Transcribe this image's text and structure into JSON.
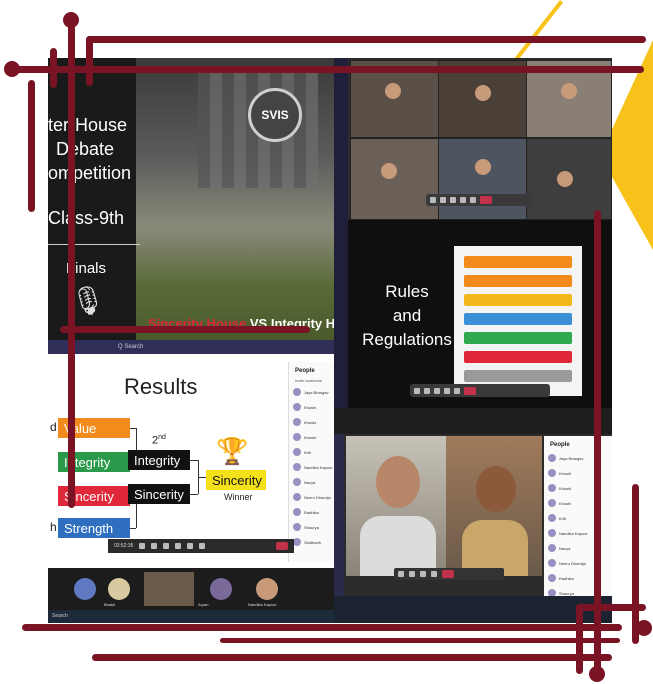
{
  "slide1": {
    "title_lines": [
      "ter-House",
      "Debate",
      "ompetition"
    ],
    "class_label": "Class-9th",
    "finals_label": "Finals",
    "building_sign": "SVIS",
    "vs_left": "Sincerity House",
    "vs_mid": " VS ",
    "vs_right": "Integrity H"
  },
  "slide2": {
    "title_lines": [
      "Rules",
      "and",
      "Regulations"
    ],
    "rules": [
      {
        "color": "#f28a1c"
      },
      {
        "color": "#f28a1c"
      },
      {
        "color": "#f2b81c"
      },
      {
        "color": "#3a8fd6"
      },
      {
        "color": "#2fa84f"
      },
      {
        "color": "#e0283a"
      },
      {
        "color": "#9a9a9a"
      }
    ]
  },
  "results": {
    "search_placeholder": "Q Search",
    "title": "Results",
    "round1": [
      {
        "prefix": "d",
        "label": "Value",
        "color": "#f28a1c"
      },
      {
        "prefix": "",
        "label": "Integrity",
        "color": "#2a9a4a"
      },
      {
        "prefix": "",
        "label": "Sincerity",
        "color": "#e0283a"
      },
      {
        "prefix": "h",
        "label": "Strength",
        "color": "#2f6fc0"
      }
    ],
    "round2_heading": "2",
    "round2_sup": "nd",
    "round2": [
      "Integrity",
      "Sincerity"
    ],
    "winner_box": "Sincerity",
    "winner_label": "Winner",
    "call_time": "03:52:35"
  },
  "people_panel": {
    "title": "People",
    "invite": "Invite someone",
    "names": [
      "Jaya Bhargav",
      "Khushi",
      "Khushi",
      "Khushi",
      "Kriti",
      "Nandika Kapoor",
      "Navya",
      "Neeru Dhamija",
      "Radhika",
      "Shaurya",
      "Siddharth",
      "Snehal"
    ]
  },
  "taskbar": {
    "search": "Search"
  },
  "strip_names": [
    "Bhakti",
    "Aryan",
    "Nandika Kapoor"
  ],
  "colors": {
    "maroon": "#7a1323",
    "yellow": "#f7c21a",
    "teams_end_call": "#c4314b"
  }
}
